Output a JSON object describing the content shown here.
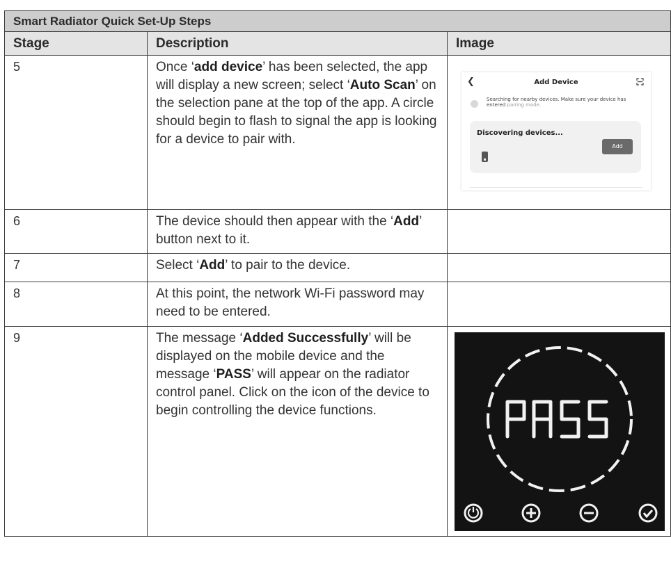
{
  "table": {
    "title": "Smart Radiator Quick Set-Up Steps",
    "headers": {
      "stage": "Stage",
      "description": "Description",
      "image": "Image"
    }
  },
  "rows": [
    {
      "stage": "5",
      "desc": {
        "t1": "Once ‘",
        "b1": "add device",
        "t2": "’ has been selected, the app will display a new screen; select ‘",
        "b2": "Auto Scan",
        "t3": "’ on the selection pane at the top of the app. A circle should begin to flash to signal the app is looking for a device to pair with."
      }
    },
    {
      "stage": "6",
      "desc": {
        "t1": "The device should then appear with the ‘",
        "b1": "Add",
        "t2": "’ button next to it."
      }
    },
    {
      "stage": "7",
      "desc": {
        "t1": "Select ‘",
        "b1": "Add",
        "t2": "’ to pair to the device."
      }
    },
    {
      "stage": "8",
      "desc": {
        "t1": "At this point, the network Wi-Fi password may need to be entered."
      }
    },
    {
      "stage": "9",
      "desc": {
        "t1": "The message ‘",
        "b1": "Added Successfully",
        "t2": "’ will be displayed on the mobile device and the message ‘",
        "b2": "PASS",
        "t3": "’ will appear on the radiator control panel. Click on the icon of the device to begin controlling the device functions."
      }
    }
  ],
  "app_screenshot": {
    "back_icon": "chevron-left-icon",
    "title": "Add Device",
    "scan_icon": "scan-icon",
    "search_msg": "Searching for nearby devices. Make sure your device has entered",
    "search_msg_highlight": "pairing mode.",
    "discovering": "Discovering devices...",
    "add_button": "Add"
  },
  "radiator_panel": {
    "display": "PASS",
    "buttons": [
      "power-icon",
      "plus-icon",
      "minus-icon",
      "check-icon"
    ]
  }
}
